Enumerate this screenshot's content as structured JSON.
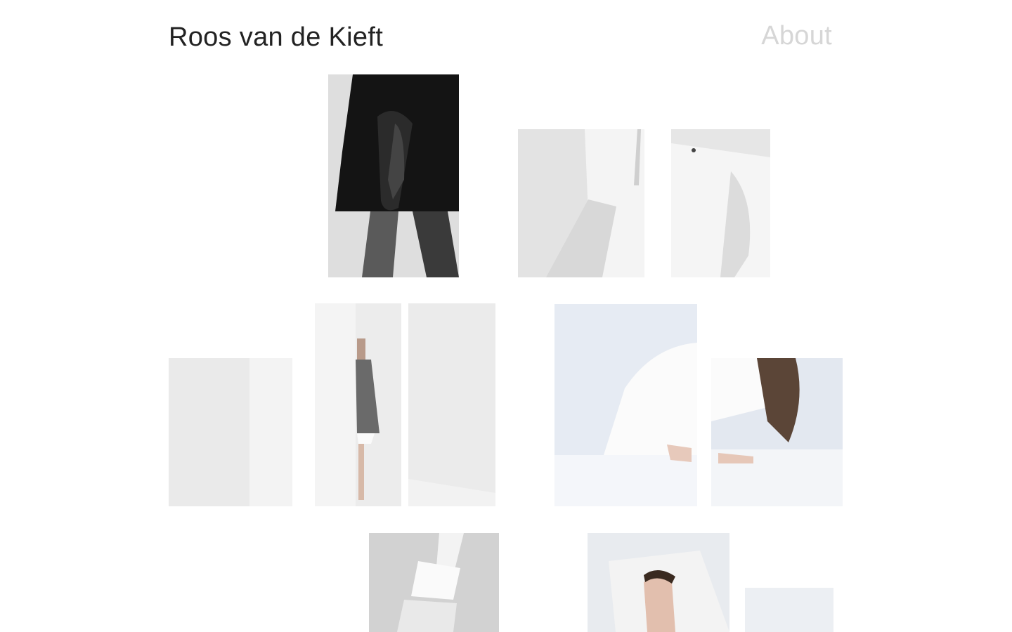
{
  "header": {
    "site_title": "Roos van de Kieft",
    "nav_about_label": "About"
  },
  "gallery": {
    "photos": [
      {
        "subject": "dark skirt with clasped hands, black and white"
      },
      {
        "subject": "white sleeve detail"
      },
      {
        "subject": "white shirt with button detail"
      },
      {
        "subject": "empty white wall corner"
      },
      {
        "subject": "model behind white wall wearing grey coat"
      },
      {
        "subject": "white wall panel"
      },
      {
        "subject": "model in white shirt leaning on table"
      },
      {
        "subject": "model with long hair leaning on table"
      },
      {
        "subject": "model lying on the floor, black and white"
      },
      {
        "subject": "portrait face over open book page"
      },
      {
        "subject": "pale light panel"
      }
    ]
  }
}
